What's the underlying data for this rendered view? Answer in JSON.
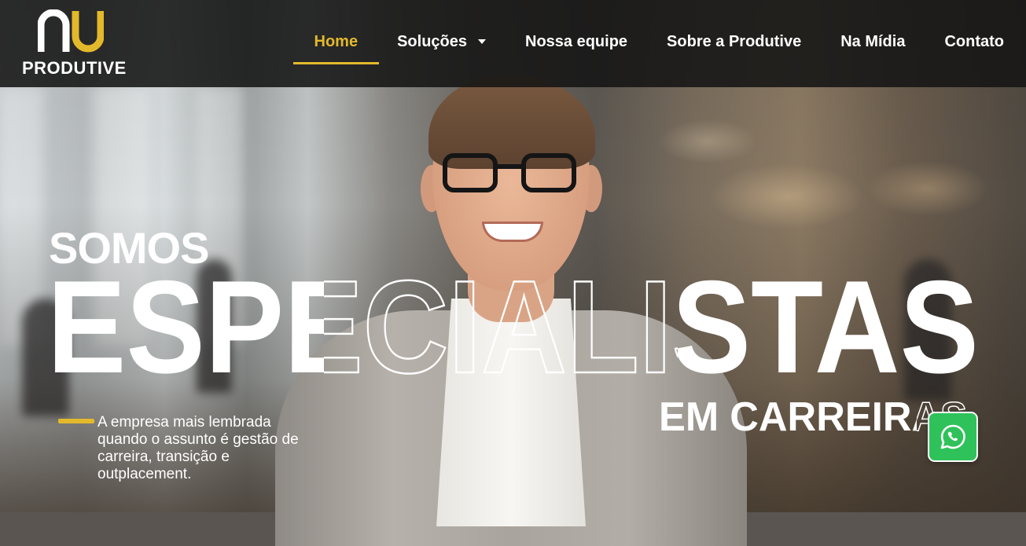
{
  "brand": {
    "name": "PRODUTIVE",
    "logo_mark_icon": "nu-logo-icon",
    "accent_color": "#e3b92c"
  },
  "nav": {
    "items": [
      {
        "label": "Home",
        "active": true
      },
      {
        "label": "Soluções",
        "has_dropdown": true
      },
      {
        "label": "Nossa equipe"
      },
      {
        "label": "Sobre a Produtive"
      },
      {
        "label": "Na Mídia"
      },
      {
        "label": "Contato"
      }
    ]
  },
  "hero": {
    "line1": "SOMOS",
    "line2": "ESPECIALISTAS",
    "line3": "EM CARREIRAS",
    "tagline": "A empresa mais lembrada quando o assunto é gestão de carreira, transição e outplacement."
  },
  "whatsapp": {
    "icon": "whatsapp-icon",
    "color": "#2fc25a"
  }
}
